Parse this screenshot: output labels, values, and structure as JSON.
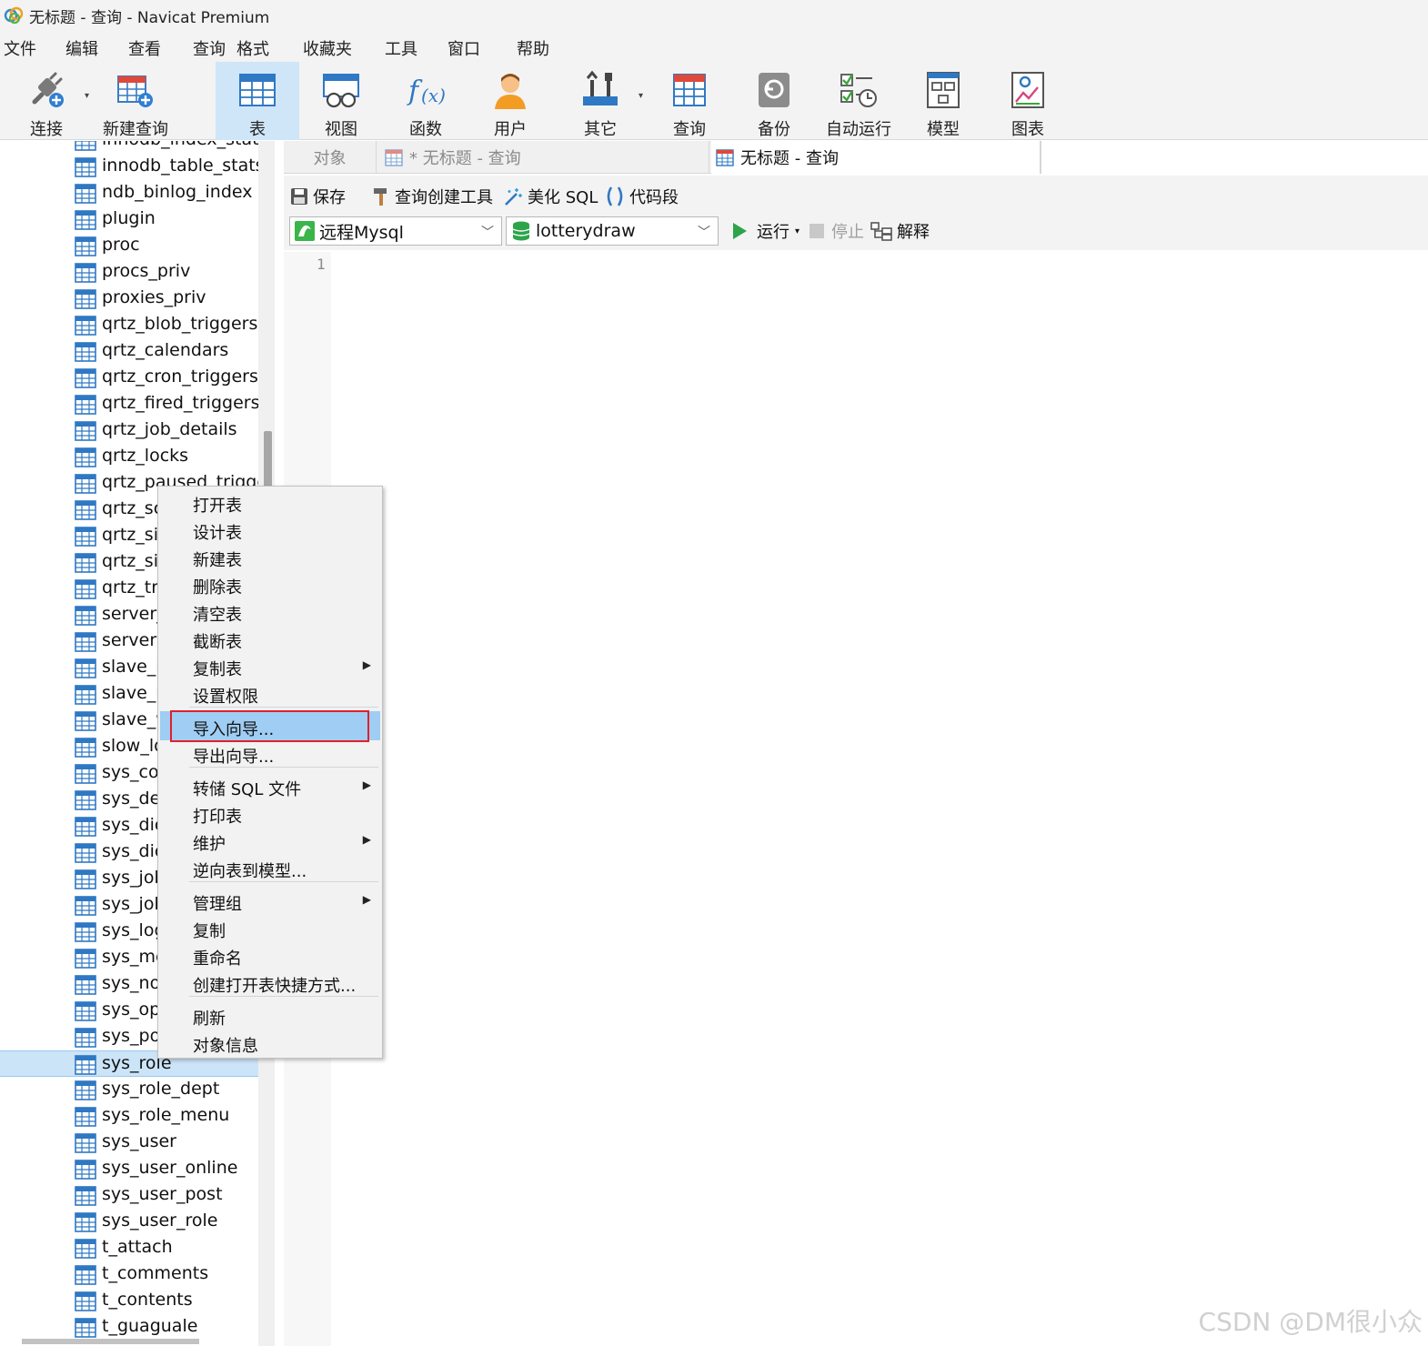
{
  "window": {
    "title": "无标题 - 查询 - Navicat Premium"
  },
  "menubar": {
    "items": [
      "文件",
      "编辑",
      "查看",
      "查询",
      "格式",
      "收藏夹",
      "工具",
      "窗口",
      "帮助"
    ]
  },
  "toolbar": {
    "buttons": [
      {
        "label": "连接",
        "icon": "plug-icon"
      },
      {
        "label": "新建查询",
        "icon": "new-query-icon"
      },
      {
        "label": "表",
        "icon": "table-icon"
      },
      {
        "label": "视图",
        "icon": "view-icon"
      },
      {
        "label": "函数",
        "icon": "function-icon"
      },
      {
        "label": "用户",
        "icon": "user-icon"
      },
      {
        "label": "其它",
        "icon": "tools-icon"
      },
      {
        "label": "查询",
        "icon": "query-icon"
      },
      {
        "label": "备份",
        "icon": "backup-icon"
      },
      {
        "label": "自动运行",
        "icon": "schedule-icon"
      },
      {
        "label": "模型",
        "icon": "model-icon"
      },
      {
        "label": "图表",
        "icon": "chart-icon"
      }
    ],
    "active": "表"
  },
  "sidebar": {
    "tables": [
      "innodb_index_stats",
      "innodb_table_stats",
      "ndb_binlog_index",
      "plugin",
      "proc",
      "procs_priv",
      "proxies_priv",
      "qrtz_blob_triggers",
      "qrtz_calendars",
      "qrtz_cron_triggers",
      "qrtz_fired_triggers",
      "qrtz_job_details",
      "qrtz_locks",
      "qrtz_paused_trigger",
      "qrtz_sc",
      "qrtz_si",
      "qrtz_si",
      "qrtz_tri",
      "server_",
      "servers",
      "slave_m",
      "slave_re",
      "slave_w",
      "slow_lo",
      "sys_cor",
      "sys_dep",
      "sys_dic",
      "sys_dic",
      "sys_job",
      "sys_job",
      "sys_log",
      "sys_me",
      "sys_not",
      "sys_ope",
      "sys_pos",
      "sys_role",
      "sys_role_dept",
      "sys_role_menu",
      "sys_user",
      "sys_user_online",
      "sys_user_post",
      "sys_user_role",
      "t_attach",
      "t_comments",
      "t_contents",
      "t_guaguale"
    ],
    "selected": "sys_role"
  },
  "tabs": {
    "objects": "对象",
    "inactive": "* 无标题 - 查询",
    "active": "无标题 - 查询"
  },
  "query_toolbar": {
    "save": "保存",
    "builder": "查询创建工具",
    "beautify": "美化 SQL",
    "snippet": "代码段",
    "connection": "远程Mysql",
    "database": "lotterydraw",
    "run": "运行",
    "stop": "停止",
    "explain": "解释"
  },
  "editor": {
    "line_number": "1"
  },
  "context_menu": {
    "items": [
      {
        "label": "打开表"
      },
      {
        "label": "设计表"
      },
      {
        "label": "新建表"
      },
      {
        "label": "删除表"
      },
      {
        "label": "清空表"
      },
      {
        "label": "截断表"
      },
      {
        "label": "复制表",
        "submenu": true
      },
      {
        "label": "设置权限"
      },
      {
        "label": "导入向导...",
        "highlighted": true
      },
      {
        "label": "导出向导..."
      },
      {
        "label": "转储 SQL 文件",
        "submenu": true
      },
      {
        "label": "打印表"
      },
      {
        "label": "维护",
        "submenu": true
      },
      {
        "label": "逆向表到模型..."
      },
      {
        "label": "管理组",
        "submenu": true
      },
      {
        "label": "复制"
      },
      {
        "label": "重命名"
      },
      {
        "label": "创建打开表快捷方式..."
      },
      {
        "label": "刷新"
      },
      {
        "label": "对象信息"
      }
    ]
  },
  "watermark": "CSDN @DM很小众"
}
